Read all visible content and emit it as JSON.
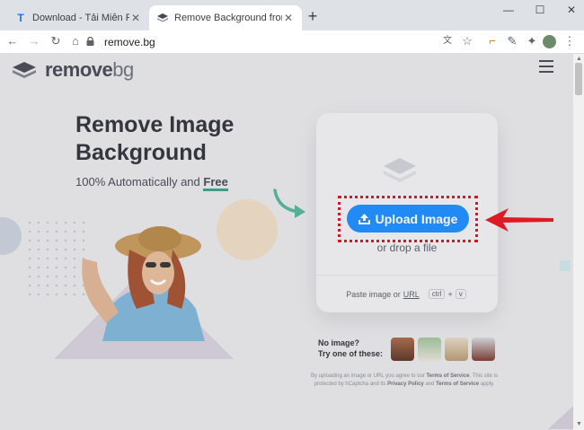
{
  "browser": {
    "tabs": [
      {
        "title": "Download - Tải Miễn Phí VN - Ph...",
        "active": false,
        "favicon": "T"
      },
      {
        "title": "Remove Background from Image",
        "active": true,
        "favicon": "removebg"
      }
    ],
    "address": "remove.bg"
  },
  "site": {
    "logo_main": "remove",
    "logo_light": "bg",
    "hero_line1": "Remove Image",
    "hero_line2": "Background",
    "hero_sub": "100% Automatically and ",
    "hero_free": "Free",
    "upload_label": "Upload Image",
    "drop_text": "or drop a file",
    "paste_text": "Paste image or",
    "paste_url": "URL",
    "kbd_ctrl": "ctrl",
    "kbd_plus": "+",
    "kbd_v": "v",
    "no_image_1": "No image?",
    "no_image_2": "Try one of these:",
    "legal_1": "By uploading an image or URL you agree to our ",
    "legal_tos": "Terms of Service",
    "legal_2": ". This site is protected by hCaptcha and its ",
    "legal_privacy": "Privacy Policy",
    "legal_3": " and ",
    "legal_tos2": "Terms of Service",
    "legal_4": " apply."
  },
  "colors": {
    "upload_button": "#1c8dff",
    "highlight_frame": "#d8121c",
    "red_arrow": "#e8141e",
    "green_arrow": "#55b59a"
  },
  "icons": [
    "back-icon",
    "forward-icon",
    "reload-icon",
    "lock-icon",
    "translate-icon",
    "star-icon",
    "extension-icon",
    "eyedropper-icon",
    "puzzle-icon",
    "menu-dots-icon",
    "hamburger-icon",
    "upload-icon"
  ]
}
